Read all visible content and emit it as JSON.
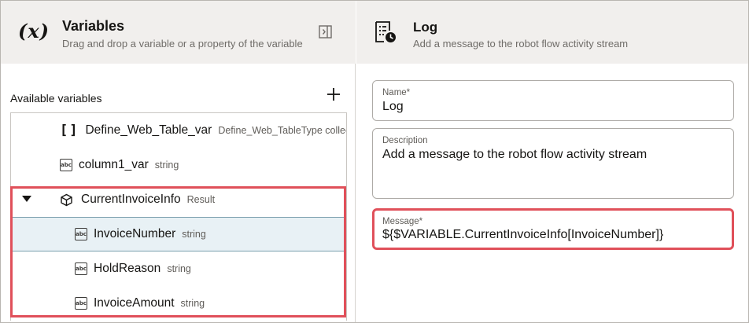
{
  "variables_panel": {
    "icon_text": "(x)",
    "title": "Variables",
    "subtitle": "Drag and drop a variable or a property of the variable",
    "available_label": "Available variables",
    "items": [
      {
        "name": "Define_Web_Table_var",
        "type": "Define_Web_TableType collec",
        "icon": "brackets-icon"
      },
      {
        "name": "column1_var",
        "type": "string",
        "icon": "abc-icon"
      },
      {
        "name": "CurrentInvoiceInfo",
        "type": "Result",
        "icon": "cube-icon",
        "expanded": true
      },
      {
        "name": "InvoiceNumber",
        "type": "string",
        "icon": "abc-icon",
        "selected": true
      },
      {
        "name": "HoldReason",
        "type": "string",
        "icon": "abc-icon"
      },
      {
        "name": "InvoiceAmount",
        "type": "string",
        "icon": "abc-icon"
      }
    ],
    "abc_glyph": "abc",
    "brackets_glyph": "[]"
  },
  "log_panel": {
    "title": "Log",
    "subtitle": "Add a message to the robot flow activity stream",
    "fields": {
      "name": {
        "label": "Name*",
        "value": "Log"
      },
      "description": {
        "label": "Description",
        "value": "Add a message to the robot flow activity stream"
      },
      "message": {
        "label": "Message*",
        "value": "${$VARIABLE.CurrentInvoiceInfo[InvoiceNumber]}"
      }
    }
  },
  "colors": {
    "header_bg": "#f1efed",
    "highlight": "#e0505a",
    "selected_row": "#e8f1f5"
  }
}
